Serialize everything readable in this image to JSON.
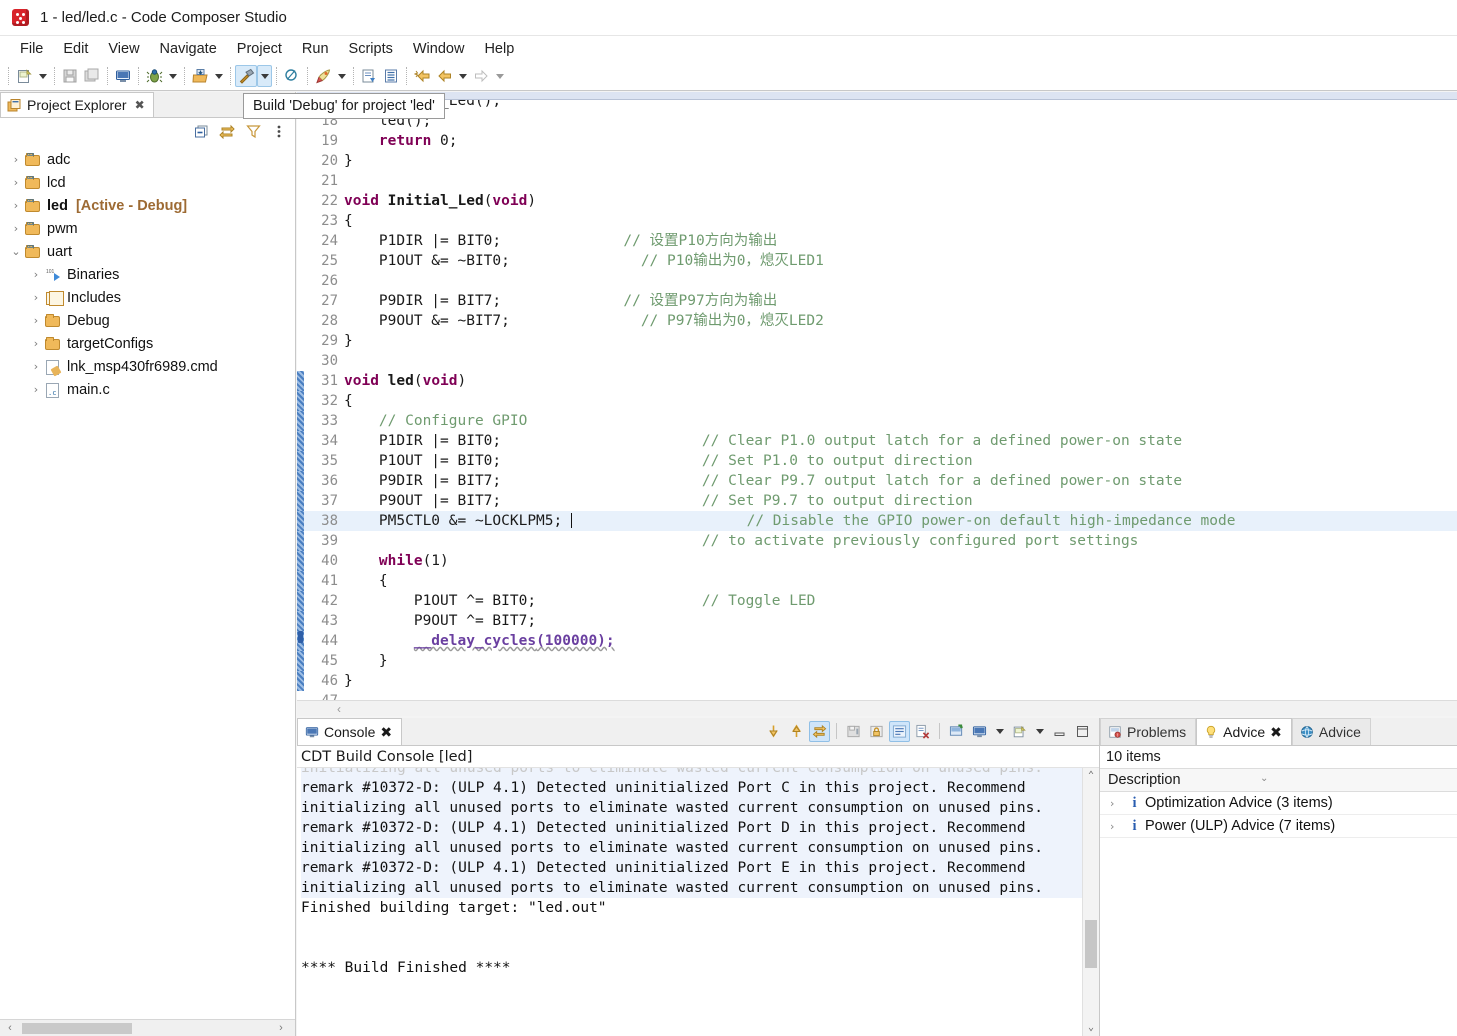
{
  "window": {
    "title": "1 - led/led.c - Code Composer Studio",
    "icon": "ccs-cube-icon"
  },
  "menubar": {
    "items": [
      "File",
      "Edit",
      "View",
      "Navigate",
      "Project",
      "Run",
      "Scripts",
      "Window",
      "Help"
    ]
  },
  "toolbar": {
    "buttons": [
      {
        "name": "new-button",
        "icon": "new-file-icon"
      },
      {
        "name": "new-dropdown",
        "icon": "chevron-down-icon"
      },
      {
        "name": "save-button",
        "icon": "save-icon"
      },
      {
        "name": "save-all-button",
        "icon": "save-all-icon"
      },
      {
        "name": "open-console-button",
        "icon": "console-icon"
      },
      {
        "name": "debug-button",
        "icon": "debug-bug-icon"
      },
      {
        "name": "debug-dropdown",
        "icon": "chevron-down-icon"
      },
      {
        "name": "download-button",
        "icon": "download-icon"
      },
      {
        "name": "download-dropdown",
        "icon": "chevron-down-icon"
      },
      {
        "name": "build-button",
        "icon": "hammer-icon"
      },
      {
        "name": "build-dropdown",
        "icon": "chevron-down-icon"
      },
      {
        "name": "search-button",
        "icon": "search-icon"
      },
      {
        "name": "run-button",
        "icon": "rocket-icon"
      },
      {
        "name": "run-dropdown",
        "icon": "chevron-down-icon"
      },
      {
        "name": "import-button",
        "icon": "import-project-icon"
      },
      {
        "name": "properties-button",
        "icon": "properties-icon"
      },
      {
        "name": "back-marker-button",
        "icon": "back-marker-icon"
      },
      {
        "name": "back-button",
        "icon": "back-arrow-icon"
      },
      {
        "name": "back-dropdown",
        "icon": "chevron-down-icon"
      },
      {
        "name": "forward-button",
        "icon": "forward-arrow-icon"
      },
      {
        "name": "forward-dropdown",
        "icon": "chevron-down-icon"
      }
    ]
  },
  "tooltip": {
    "text": "Build 'Debug' for project 'led'"
  },
  "explorer": {
    "tab_label": "Project Explorer",
    "tab_icon": "project-explorer-icon",
    "close_glyph": "✖",
    "tools": [
      {
        "name": "collapse-all-icon"
      },
      {
        "name": "link-with-editor-icon"
      },
      {
        "name": "filter-icon"
      },
      {
        "name": "view-menu-icon"
      }
    ],
    "tree": [
      {
        "twist": "›",
        "icon": "ccs-project-folder-icon",
        "label": "adc",
        "bold": false,
        "indent": 0,
        "tag": ""
      },
      {
        "twist": "›",
        "icon": "ccs-project-folder-icon",
        "label": "lcd",
        "bold": false,
        "indent": 0,
        "tag": ""
      },
      {
        "twist": "›",
        "icon": "ccs-project-folder-icon",
        "label": "led",
        "bold": true,
        "indent": 0,
        "tag": "[Active - Debug]"
      },
      {
        "twist": "›",
        "icon": "ccs-project-folder-icon",
        "label": "pwm",
        "bold": false,
        "indent": 0,
        "tag": ""
      },
      {
        "twist": "⌄",
        "icon": "ccs-project-folder-icon",
        "label": "uart",
        "bold": false,
        "indent": 0,
        "tag": ""
      },
      {
        "twist": "›",
        "icon": "binaries-icon",
        "label": "Binaries",
        "bold": false,
        "indent": 1,
        "tag": ""
      },
      {
        "twist": "›",
        "icon": "includes-icon",
        "label": "Includes",
        "bold": false,
        "indent": 1,
        "tag": ""
      },
      {
        "twist": "›",
        "icon": "folder-icon",
        "label": "Debug",
        "bold": false,
        "indent": 1,
        "tag": ""
      },
      {
        "twist": "›",
        "icon": "folder-icon",
        "label": "targetConfigs",
        "bold": false,
        "indent": 1,
        "tag": ""
      },
      {
        "twist": "›",
        "icon": "cmd-file-icon",
        "label": "lnk_msp430fr6989.cmd",
        "bold": false,
        "indent": 1,
        "tag": ""
      },
      {
        "twist": "›",
        "icon": "c-file-icon",
        "label": "main.c",
        "bold": false,
        "indent": 1,
        "tag": ""
      }
    ]
  },
  "editor": {
    "lines": [
      {
        "n": 17,
        "changed": false,
        "hl": false,
        "clipped": true,
        "tokens": [
          {
            "t": "    Initial_Led();",
            "c": "pl"
          }
        ]
      },
      {
        "n": 18,
        "changed": false,
        "hl": false,
        "tokens": [
          {
            "t": "    led();",
            "c": "pl"
          }
        ]
      },
      {
        "n": 19,
        "changed": false,
        "hl": false,
        "tokens": [
          {
            "t": "    ",
            "c": "pl"
          },
          {
            "t": "return",
            "c": "kw"
          },
          {
            "t": " 0;",
            "c": "pl"
          }
        ]
      },
      {
        "n": 20,
        "changed": false,
        "hl": false,
        "tokens": [
          {
            "t": "}",
            "c": "pl"
          }
        ]
      },
      {
        "n": 21,
        "changed": false,
        "hl": false,
        "tokens": [
          {
            "t": "",
            "c": "pl"
          }
        ]
      },
      {
        "n": 22,
        "changed": false,
        "hl": false,
        "tokens": [
          {
            "t": "void",
            "c": "kw"
          },
          {
            "t": " ",
            "c": "pl"
          },
          {
            "t": "Initial_Led",
            "c": "fn"
          },
          {
            "t": "(",
            "c": "pl"
          },
          {
            "t": "void",
            "c": "kw"
          },
          {
            "t": ")",
            "c": "pl"
          }
        ]
      },
      {
        "n": 23,
        "changed": false,
        "hl": false,
        "tokens": [
          {
            "t": "{",
            "c": "pl"
          }
        ]
      },
      {
        "n": 24,
        "changed": false,
        "hl": false,
        "tokens": [
          {
            "t": "    P1DIR |= BIT0;              ",
            "c": "pl"
          },
          {
            "t": "// 设置P10方向为输出",
            "c": "cm"
          }
        ]
      },
      {
        "n": 25,
        "changed": false,
        "hl": false,
        "tokens": [
          {
            "t": "    P1OUT &= ~BIT0;               ",
            "c": "pl"
          },
          {
            "t": "// P10输出为0，熄灭LED1",
            "c": "cm"
          }
        ]
      },
      {
        "n": 26,
        "changed": false,
        "hl": false,
        "tokens": [
          {
            "t": "",
            "c": "pl"
          }
        ]
      },
      {
        "n": 27,
        "changed": false,
        "hl": false,
        "tokens": [
          {
            "t": "    P9DIR |= BIT7;              ",
            "c": "pl"
          },
          {
            "t": "// 设置P97方向为输出",
            "c": "cm"
          }
        ]
      },
      {
        "n": 28,
        "changed": false,
        "hl": false,
        "tokens": [
          {
            "t": "    P9OUT &= ~BIT7;               ",
            "c": "pl"
          },
          {
            "t": "// P97输出为0，熄灭LED2",
            "c": "cm"
          }
        ]
      },
      {
        "n": 29,
        "changed": false,
        "hl": false,
        "tokens": [
          {
            "t": "}",
            "c": "pl"
          }
        ]
      },
      {
        "n": 30,
        "changed": false,
        "hl": false,
        "tokens": [
          {
            "t": "",
            "c": "pl"
          }
        ]
      },
      {
        "n": 31,
        "changed": true,
        "hl": false,
        "tokens": [
          {
            "t": "void",
            "c": "kw"
          },
          {
            "t": " ",
            "c": "pl"
          },
          {
            "t": "led",
            "c": "fn"
          },
          {
            "t": "(",
            "c": "pl"
          },
          {
            "t": "void",
            "c": "kw"
          },
          {
            "t": ")",
            "c": "pl"
          }
        ]
      },
      {
        "n": 32,
        "changed": true,
        "hl": false,
        "tokens": [
          {
            "t": "{",
            "c": "pl"
          }
        ]
      },
      {
        "n": 33,
        "changed": true,
        "hl": false,
        "tokens": [
          {
            "t": "    ",
            "c": "pl"
          },
          {
            "t": "// Configure GPIO",
            "c": "cm"
          }
        ]
      },
      {
        "n": 34,
        "changed": true,
        "hl": false,
        "tokens": [
          {
            "t": "    P1DIR |= BIT0;                       ",
            "c": "pl"
          },
          {
            "t": "// Clear P1.0 output latch for a defined power-on state",
            "c": "cm"
          }
        ]
      },
      {
        "n": 35,
        "changed": true,
        "hl": false,
        "tokens": [
          {
            "t": "    P1OUT |= BIT0;                       ",
            "c": "pl"
          },
          {
            "t": "// Set P1.0 to output direction",
            "c": "cm"
          }
        ]
      },
      {
        "n": 36,
        "changed": true,
        "hl": false,
        "tokens": [
          {
            "t": "    P9DIR |= BIT7;                       ",
            "c": "pl"
          },
          {
            "t": "// Clear P9.7 output latch for a defined power-on state",
            "c": "cm"
          }
        ]
      },
      {
        "n": 37,
        "changed": true,
        "hl": false,
        "tokens": [
          {
            "t": "    P9OUT |= BIT7;                       ",
            "c": "pl"
          },
          {
            "t": "// Set P9.7 to output direction",
            "c": "cm"
          }
        ]
      },
      {
        "n": 38,
        "changed": true,
        "hl": true,
        "caret": true,
        "tokens": [
          {
            "t": "    PM5CTL0 &= ~LOCKLPM5; ",
            "c": "pl"
          },
          {
            "t": "|CARET|",
            "c": "caret"
          },
          {
            "t": "                    ",
            "c": "pl"
          },
          {
            "t": "// Disable the GPIO power-on default high-impedance mode",
            "c": "cm"
          }
        ]
      },
      {
        "n": 39,
        "changed": true,
        "hl": false,
        "tokens": [
          {
            "t": "                                         ",
            "c": "pl"
          },
          {
            "t": "// to activate previously configured port settings",
            "c": "cm"
          }
        ]
      },
      {
        "n": 40,
        "changed": true,
        "hl": false,
        "tokens": [
          {
            "t": "    ",
            "c": "pl"
          },
          {
            "t": "while",
            "c": "kw"
          },
          {
            "t": "(1)",
            "c": "pl"
          }
        ]
      },
      {
        "n": 41,
        "changed": true,
        "hl": false,
        "tokens": [
          {
            "t": "    {",
            "c": "pl"
          }
        ]
      },
      {
        "n": 42,
        "changed": true,
        "hl": false,
        "tokens": [
          {
            "t": "        P1OUT ^= BIT0;                   ",
            "c": "pl"
          },
          {
            "t": "// Toggle LED",
            "c": "cm"
          }
        ]
      },
      {
        "n": 43,
        "changed": true,
        "hl": false,
        "tokens": [
          {
            "t": "        P9OUT ^= BIT7;",
            "c": "pl"
          }
        ]
      },
      {
        "n": 44,
        "changed": true,
        "hl": false,
        "marker": true,
        "tokens": [
          {
            "t": "        ",
            "c": "pl"
          },
          {
            "t": "__delay_cycles",
            "c": "underline-err"
          },
          {
            "t": "(100000);",
            "c": "underline-err-plain"
          }
        ]
      },
      {
        "n": 45,
        "changed": true,
        "hl": false,
        "tokens": [
          {
            "t": "    }",
            "c": "pl"
          }
        ]
      },
      {
        "n": 46,
        "changed": true,
        "hl": false,
        "tokens": [
          {
            "t": "}",
            "c": "pl"
          }
        ]
      },
      {
        "n": 47,
        "changed": false,
        "hl": false,
        "tokens": [
          {
            "t": "",
            "c": "pl"
          }
        ]
      }
    ]
  },
  "console": {
    "tab_label": "Console",
    "tab_icon": "console-icon",
    "close_glyph": "✖",
    "subtitle": "CDT Build Console [led]",
    "toolbar": [
      {
        "name": "scroll-down-button",
        "icon": "arrow-down-icon"
      },
      {
        "name": "scroll-up-button",
        "icon": "arrow-up-icon"
      },
      {
        "name": "scroll-lock-button",
        "icon": "scroll-lock-icon",
        "on": true
      },
      {
        "name": "save-console-button",
        "icon": "save-console-icon"
      },
      {
        "name": "lock-console-button",
        "icon": "lock-icon"
      },
      {
        "name": "word-wrap-button",
        "icon": "word-wrap-icon",
        "on": true
      },
      {
        "name": "clear-console-button",
        "icon": "clear-console-icon"
      },
      {
        "name": "pin-console-button",
        "icon": "pin-console-icon"
      },
      {
        "name": "display-console-button",
        "icon": "display-console-icon"
      },
      {
        "name": "display-console-dropdown",
        "icon": "chevron-down-icon"
      },
      {
        "name": "new-console-button",
        "icon": "new-console-icon"
      },
      {
        "name": "new-console-dropdown",
        "icon": "chevron-down-icon"
      },
      {
        "name": "minimize-panel-button",
        "icon": "minimize-icon"
      },
      {
        "name": "maximize-panel-button",
        "icon": "maximize-icon"
      }
    ],
    "lines": [
      {
        "text": "initializing all unused ports to eliminate wasted current consumption on unused pins.",
        "sel": true,
        "clip": true
      },
      {
        "text": "remark #10372-D: (ULP 4.1) Detected uninitialized Port C in this project. Recommend",
        "sel": true
      },
      {
        "text": "initializing all unused ports to eliminate wasted current consumption on unused pins.",
        "sel": true
      },
      {
        "text": "remark #10372-D: (ULP 4.1) Detected uninitialized Port D in this project. Recommend",
        "sel": true
      },
      {
        "text": "initializing all unused ports to eliminate wasted current consumption on unused pins.",
        "sel": true
      },
      {
        "text": "remark #10372-D: (ULP 4.1) Detected uninitialized Port E in this project. Recommend",
        "sel": true
      },
      {
        "text": "initializing all unused ports to eliminate wasted current consumption on unused pins.",
        "sel": true
      },
      {
        "text": "Finished building target: \"led.out\"",
        "sel": false
      },
      {
        "text": "",
        "sel": false
      },
      {
        "text": "",
        "sel": false
      },
      {
        "text": "**** Build Finished ****",
        "sel": false
      }
    ]
  },
  "advice": {
    "tabs": [
      {
        "label": "Problems",
        "icon": "problems-icon",
        "active": false,
        "closable": false
      },
      {
        "label": "Advice",
        "icon": "lightbulb-icon",
        "active": true,
        "closable": true
      },
      {
        "label": "Advice",
        "icon": "globe-icon",
        "active": false,
        "closable": false
      }
    ],
    "close_glyph": "✖",
    "item_count": "10 items",
    "column_header": "Description",
    "rows": [
      {
        "twist": "›",
        "icon": "info-icon",
        "label": "Optimization Advice (3 items)"
      },
      {
        "twist": "›",
        "icon": "info-icon",
        "label": "Power (ULP) Advice (7 items)"
      }
    ]
  },
  "colors": {
    "accent": "#d8eaf9",
    "selection": "#e8f1fb",
    "keyword": "#7f0055",
    "comment": "#6f9b6f",
    "active_project_tag": "#9d6a33"
  }
}
